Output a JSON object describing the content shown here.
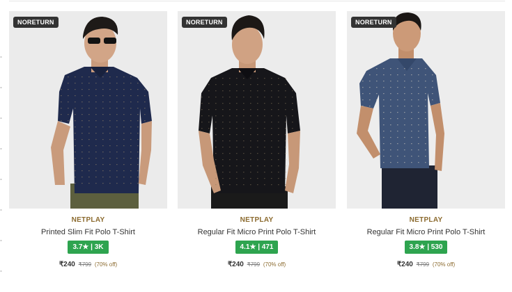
{
  "products": [
    {
      "badge": "NORETURN",
      "brand": "NETPLAY",
      "title": "Printed Slim Fit Polo T-Shirt",
      "rating": "3.7★ | 3K",
      "price": "₹240",
      "mrp": "₹799",
      "discount": "(70% off)",
      "shirt_color": "#1f2a4d",
      "pants_color": "#5c5f3e",
      "pattern": "dots"
    },
    {
      "badge": "NORETURN",
      "brand": "NETPLAY",
      "title": "Regular Fit Micro Print Polo T-Shirt",
      "rating": "4.1★ | 471",
      "price": "₹240",
      "mrp": "₹799",
      "discount": "(70% off)",
      "shirt_color": "#16161a",
      "pants_color": "#1a1a1a",
      "pattern": "dots"
    },
    {
      "badge": "NORETURN",
      "brand": "NETPLAY",
      "title": "Regular Fit Micro Print Polo T-Shirt",
      "rating": "3.8★ | 530",
      "price": "₹240",
      "mrp": "₹799",
      "discount": "(70% off)",
      "shirt_color": "#3f5478",
      "pants_color": "#1f2433",
      "pattern": "dots"
    }
  ]
}
